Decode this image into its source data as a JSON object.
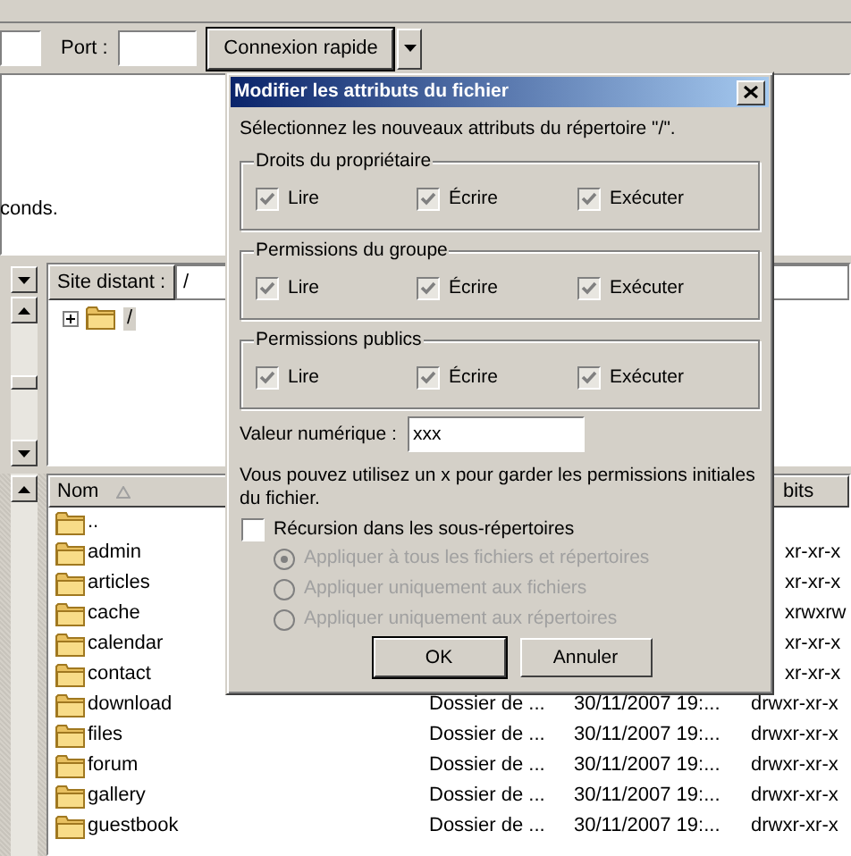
{
  "quick_connect": {
    "port_label": "Port :",
    "connect_button": "Connexion rapide"
  },
  "message_log": {
    "lines": [
      "conds."
    ]
  },
  "remote_site": {
    "label": "Site distant :",
    "path": "/",
    "tree": [
      {
        "label": "/",
        "expanded": false,
        "selected": true
      }
    ]
  },
  "file_list": {
    "columns": [
      "Nom",
      "bits"
    ],
    "rows": [
      {
        "name": ".."
      },
      {
        "name": "admin",
        "permissions": "xr-xr-x"
      },
      {
        "name": "articles",
        "permissions": "xr-xr-x"
      },
      {
        "name": "cache",
        "permissions": "xrwxrw"
      },
      {
        "name": "calendar",
        "permissions": "xr-xr-x"
      },
      {
        "name": "contact",
        "permissions": "xr-xr-x"
      },
      {
        "name": "download",
        "type": "Dossier de ...",
        "date": "30/11/2007 19:...",
        "permissions": "drwxr-xr-x"
      },
      {
        "name": "files",
        "type": "Dossier de ...",
        "date": "30/11/2007 19:...",
        "permissions": "drwxr-xr-x"
      },
      {
        "name": "forum",
        "type": "Dossier de ...",
        "date": "30/11/2007 19:...",
        "permissions": "drwxr-xr-x"
      },
      {
        "name": "gallery",
        "type": "Dossier de ...",
        "date": "30/11/2007 19:...",
        "permissions": "drwxr-xr-x"
      },
      {
        "name": "guestbook",
        "type": "Dossier de ...",
        "date": "30/11/2007 19:...",
        "permissions": "drwxr-xr-x"
      }
    ]
  },
  "dialog": {
    "title": "Modifier les attributs du fichier",
    "intro": "Sélectionnez les nouveaux attributs du répertoire \"/\".",
    "groups": [
      {
        "title": "Droits du propriétaire",
        "options": [
          {
            "label": "Lire",
            "checked": true
          },
          {
            "label": "Écrire",
            "checked": true
          },
          {
            "label": "Exécuter",
            "checked": true
          }
        ]
      },
      {
        "title": "Permissions du groupe",
        "options": [
          {
            "label": "Lire",
            "checked": true
          },
          {
            "label": "Écrire",
            "checked": true
          },
          {
            "label": "Exécuter",
            "checked": true
          }
        ]
      },
      {
        "title": "Permissions publics",
        "options": [
          {
            "label": "Lire",
            "checked": true
          },
          {
            "label": "Écrire",
            "checked": true
          },
          {
            "label": "Exécuter",
            "checked": true
          }
        ]
      }
    ],
    "numeric_label": "Valeur numérique :",
    "numeric_value": "xxx",
    "hint": "Vous pouvez utilisez un x pour garder les permissions initiales du fichier.",
    "recursion": {
      "label": "Récursion dans les sous-répertoires",
      "checked": false
    },
    "apply_options": [
      {
        "label": "Appliquer à tous les fichiers et répertoires",
        "selected": true,
        "disabled": true
      },
      {
        "label": "Appliquer uniquement aux fichiers",
        "selected": false,
        "disabled": true
      },
      {
        "label": "Appliquer uniquement aux répertoires",
        "selected": false,
        "disabled": true
      }
    ],
    "buttons": [
      "OK",
      "Annuler"
    ]
  }
}
